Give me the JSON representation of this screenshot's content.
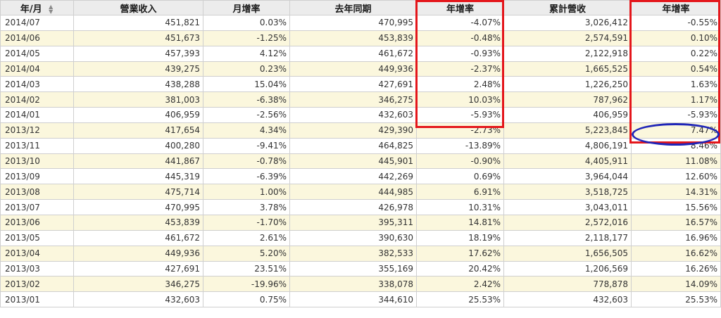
{
  "headers": {
    "month": "年/月",
    "revenue": "營業收入",
    "mom": "月增率",
    "last_year": "去年同期",
    "yoy": "年增率",
    "cumulative": "累計營收",
    "cum_yoy": "年增率"
  },
  "sort_icon": "sort-arrows-icon",
  "colors": {
    "negative": "#b02020",
    "stripe": "#fbf7dd",
    "highlight_box": "#e4161b",
    "highlight_ellipse": "#1f25b8"
  },
  "rows": [
    {
      "month": "2014/07",
      "revenue": "451,821",
      "mom": "0.03%",
      "last_year": "470,995",
      "yoy": "-4.07%",
      "cumulative": "3,026,412",
      "cum_yoy": "-0.55%"
    },
    {
      "month": "2014/06",
      "revenue": "451,673",
      "mom": "-1.25%",
      "last_year": "453,839",
      "yoy": "-0.48%",
      "cumulative": "2,574,591",
      "cum_yoy": "0.10%"
    },
    {
      "month": "2014/05",
      "revenue": "457,393",
      "mom": "4.12%",
      "last_year": "461,672",
      "yoy": "-0.93%",
      "cumulative": "2,122,918",
      "cum_yoy": "0.22%"
    },
    {
      "month": "2014/04",
      "revenue": "439,275",
      "mom": "0.23%",
      "last_year": "449,936",
      "yoy": "-2.37%",
      "cumulative": "1,665,525",
      "cum_yoy": "0.54%"
    },
    {
      "month": "2014/03",
      "revenue": "438,288",
      "mom": "15.04%",
      "last_year": "427,691",
      "yoy": "2.48%",
      "cumulative": "1,226,250",
      "cum_yoy": "1.63%"
    },
    {
      "month": "2014/02",
      "revenue": "381,003",
      "mom": "-6.38%",
      "last_year": "346,275",
      "yoy": "10.03%",
      "cumulative": "787,962",
      "cum_yoy": "1.17%"
    },
    {
      "month": "2014/01",
      "revenue": "406,959",
      "mom": "-2.56%",
      "last_year": "432,603",
      "yoy": "-5.93%",
      "cumulative": "406,959",
      "cum_yoy": "-5.93%"
    },
    {
      "month": "2013/12",
      "revenue": "417,654",
      "mom": "4.34%",
      "last_year": "429,390",
      "yoy": "-2.73%",
      "cumulative": "5,223,845",
      "cum_yoy": "7.47%"
    },
    {
      "month": "2013/11",
      "revenue": "400,280",
      "mom": "-9.41%",
      "last_year": "464,825",
      "yoy": "-13.89%",
      "cumulative": "4,806,191",
      "cum_yoy": "8.46%"
    },
    {
      "month": "2013/10",
      "revenue": "441,867",
      "mom": "-0.78%",
      "last_year": "445,901",
      "yoy": "-0.90%",
      "cumulative": "4,405,911",
      "cum_yoy": "11.08%"
    },
    {
      "month": "2013/09",
      "revenue": "445,319",
      "mom": "-6.39%",
      "last_year": "442,269",
      "yoy": "0.69%",
      "cumulative": "3,964,044",
      "cum_yoy": "12.60%"
    },
    {
      "month": "2013/08",
      "revenue": "475,714",
      "mom": "1.00%",
      "last_year": "444,985",
      "yoy": "6.91%",
      "cumulative": "3,518,725",
      "cum_yoy": "14.31%"
    },
    {
      "month": "2013/07",
      "revenue": "470,995",
      "mom": "3.78%",
      "last_year": "426,978",
      "yoy": "10.31%",
      "cumulative": "3,043,011",
      "cum_yoy": "15.56%"
    },
    {
      "month": "2013/06",
      "revenue": "453,839",
      "mom": "-1.70%",
      "last_year": "395,311",
      "yoy": "14.81%",
      "cumulative": "2,572,016",
      "cum_yoy": "16.57%"
    },
    {
      "month": "2013/05",
      "revenue": "461,672",
      "mom": "2.61%",
      "last_year": "390,630",
      "yoy": "18.19%",
      "cumulative": "2,118,177",
      "cum_yoy": "16.96%"
    },
    {
      "month": "2013/04",
      "revenue": "449,936",
      "mom": "5.20%",
      "last_year": "382,533",
      "yoy": "17.62%",
      "cumulative": "1,656,505",
      "cum_yoy": "16.62%"
    },
    {
      "month": "2013/03",
      "revenue": "427,691",
      "mom": "23.51%",
      "last_year": "355,169",
      "yoy": "20.42%",
      "cumulative": "1,206,569",
      "cum_yoy": "16.26%"
    },
    {
      "month": "2013/02",
      "revenue": "346,275",
      "mom": "-19.96%",
      "last_year": "338,078",
      "yoy": "2.42%",
      "cumulative": "778,878",
      "cum_yoy": "14.09%"
    },
    {
      "month": "2013/01",
      "revenue": "432,603",
      "mom": "0.75%",
      "last_year": "344,610",
      "yoy": "25.53%",
      "cumulative": "432,603",
      "cum_yoy": "25.53%"
    }
  ]
}
